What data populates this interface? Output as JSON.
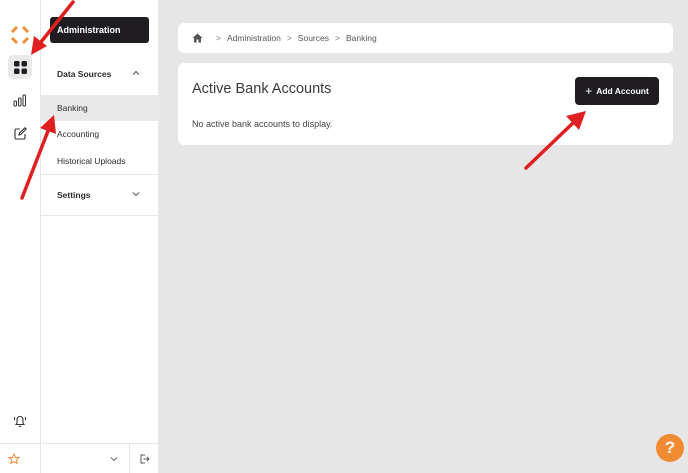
{
  "sidebar": {
    "admin_label": "Administration",
    "data_sources_label": "Data Sources",
    "items": [
      {
        "label": "Banking",
        "active": true
      },
      {
        "label": "Accounting",
        "active": false
      },
      {
        "label": "Historical Uploads",
        "active": false
      }
    ],
    "settings_label": "Settings"
  },
  "rail": {
    "icons": [
      "logo-icon",
      "dashboard-icon",
      "bar-chart-icon",
      "edit-icon",
      "bell-icon"
    ],
    "active": "dashboard-icon"
  },
  "breadcrumb": {
    "items": [
      "Administration",
      "Sources",
      "Banking"
    ],
    "separator": ">"
  },
  "main": {
    "title": "Active Bank Accounts",
    "empty_message": "No active bank accounts to display.",
    "add_button_label": "Add Account",
    "add_button_icon": "+"
  },
  "help": {
    "label": "?"
  },
  "colors": {
    "accent": "#f08a33",
    "dark_button": "#1f1d22",
    "background": "#e6e6e6",
    "annotation": "#e02020"
  }
}
